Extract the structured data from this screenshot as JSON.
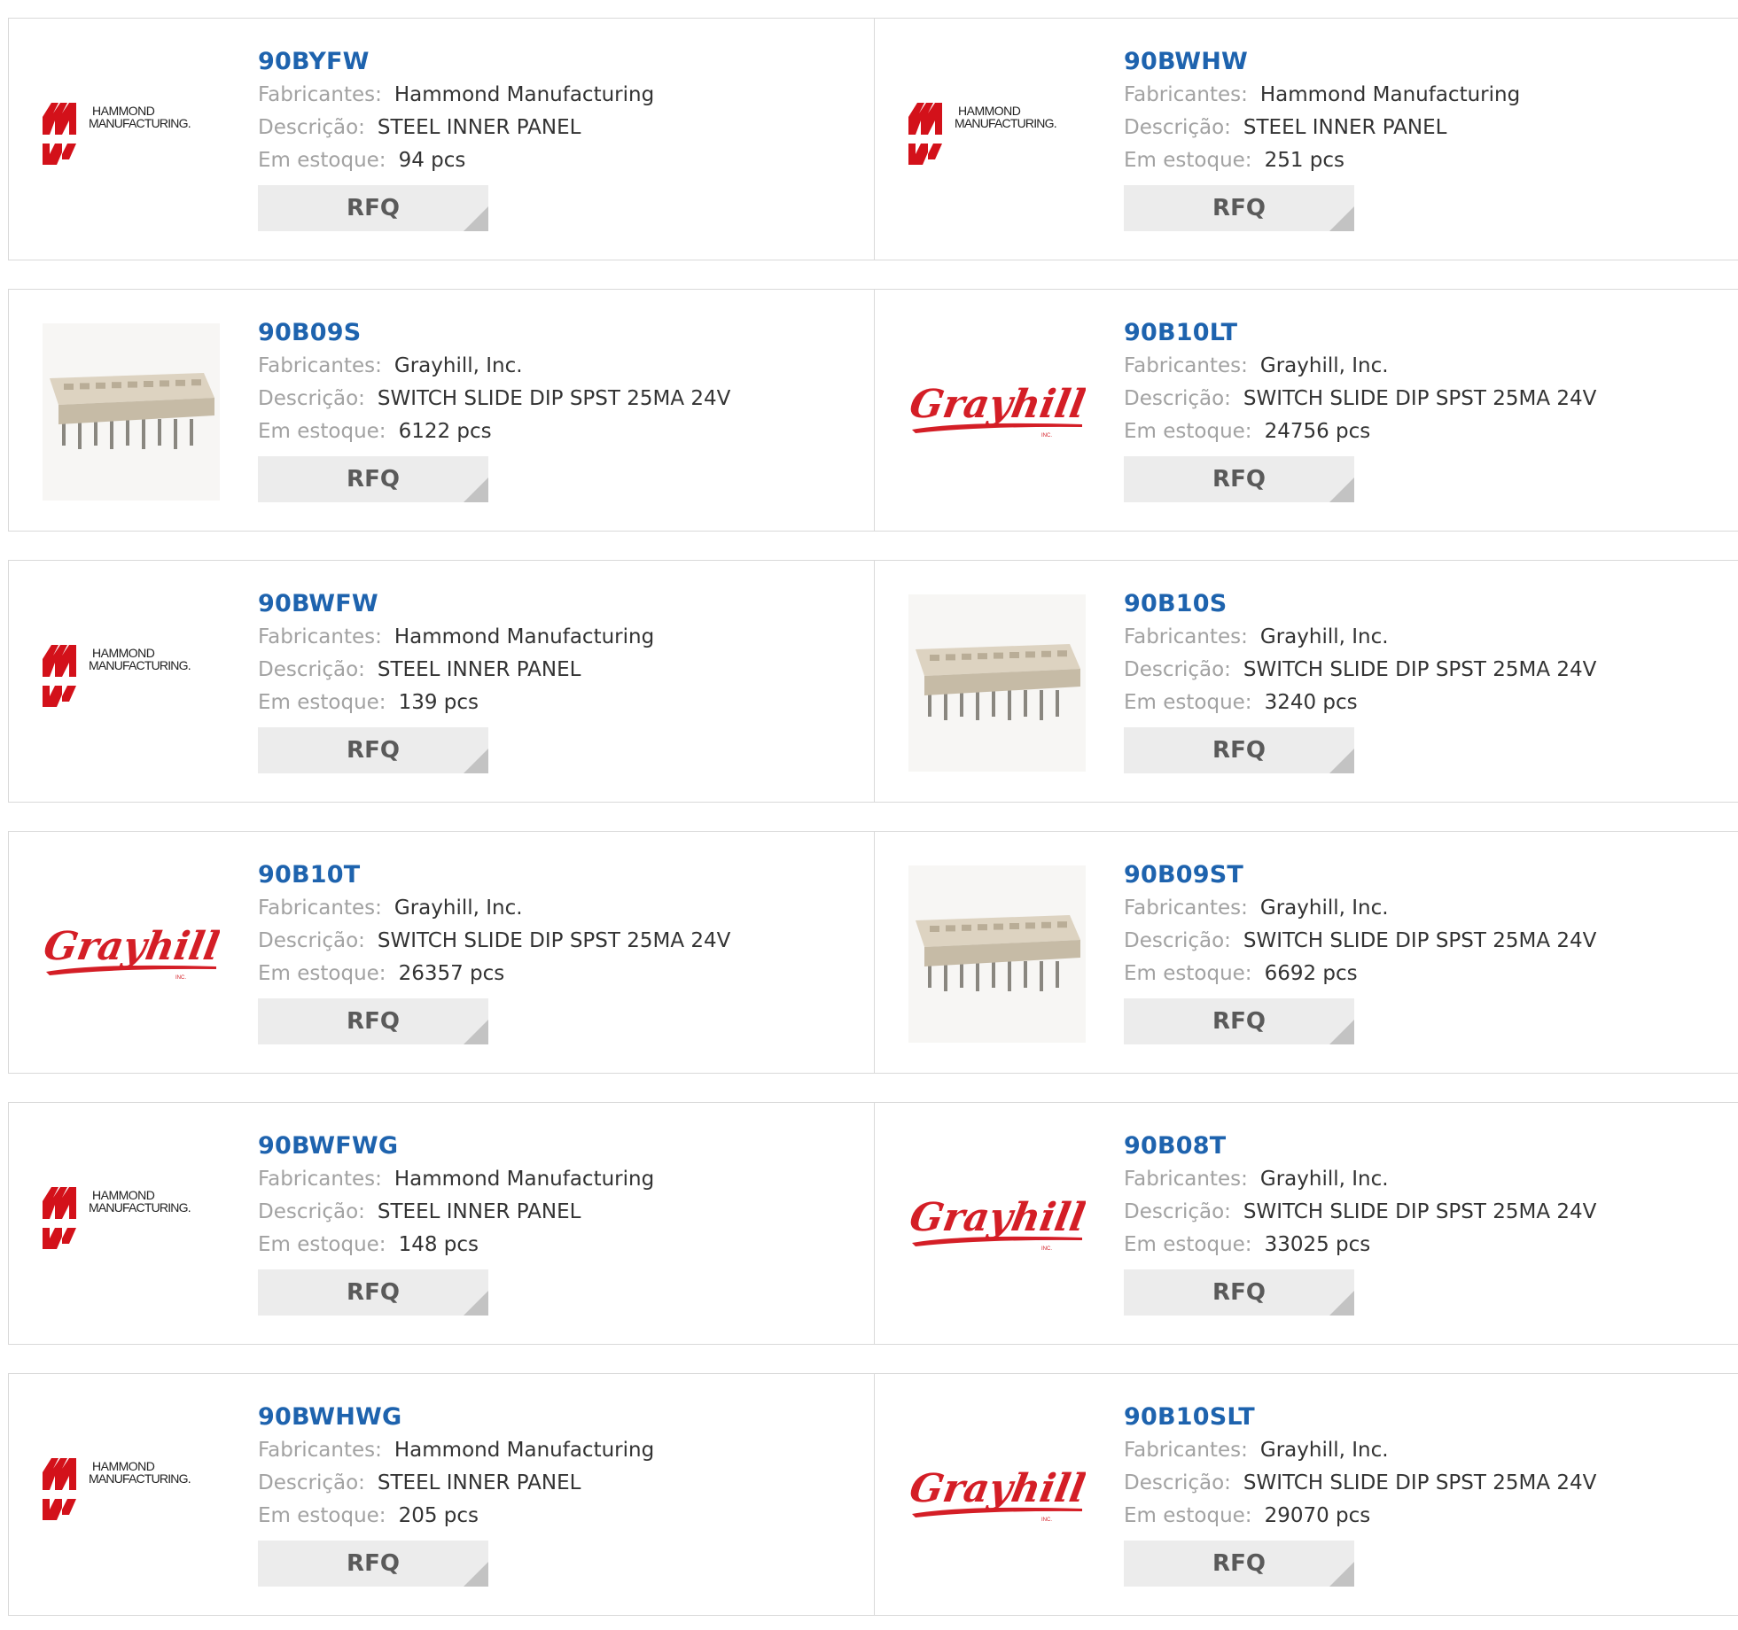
{
  "labels": {
    "manufacturer": "Fabricantes:",
    "description": "Descrição:",
    "stock": "Em estoque:",
    "rfq": "RFQ"
  },
  "colors": {
    "part_link": "#1e63ae",
    "label": "#a2a2a2",
    "hammond_red": "#d3111a",
    "grayhill_red": "#d41e26",
    "rfq_bg": "#ececec"
  },
  "logos": {
    "hammond": {
      "line1": "HAMMOND",
      "line2": "MANUFACTURING."
    },
    "grayhill": {
      "text": "Grayhill",
      "sub": "INC."
    }
  },
  "products": [
    {
      "part": "90BYFW",
      "manufacturer": "Hammond Manufacturing",
      "description": "STEEL INNER PANEL",
      "stock": "94 pcs",
      "image": "hammond-logo"
    },
    {
      "part": "90BWHW",
      "manufacturer": "Hammond Manufacturing",
      "description": "STEEL INNER PANEL",
      "stock": "251 pcs",
      "image": "hammond-logo"
    },
    {
      "part": "90B09S",
      "manufacturer": "Grayhill, Inc.",
      "description": "SWITCH SLIDE DIP SPST 25MA 24V",
      "stock": "6122 pcs",
      "image": "dip-switch-photo"
    },
    {
      "part": "90B10LT",
      "manufacturer": "Grayhill, Inc.",
      "description": "SWITCH SLIDE DIP SPST 25MA 24V",
      "stock": "24756 pcs",
      "image": "grayhill-logo"
    },
    {
      "part": "90BWFW",
      "manufacturer": "Hammond Manufacturing",
      "description": "STEEL INNER PANEL",
      "stock": "139 pcs",
      "image": "hammond-logo"
    },
    {
      "part": "90B10S",
      "manufacturer": "Grayhill, Inc.",
      "description": "SWITCH SLIDE DIP SPST 25MA 24V",
      "stock": "3240 pcs",
      "image": "dip-switch-photo"
    },
    {
      "part": "90B10T",
      "manufacturer": "Grayhill, Inc.",
      "description": "SWITCH SLIDE DIP SPST 25MA 24V",
      "stock": "26357 pcs",
      "image": "grayhill-logo"
    },
    {
      "part": "90B09ST",
      "manufacturer": "Grayhill, Inc.",
      "description": "SWITCH SLIDE DIP SPST 25MA 24V",
      "stock": "6692 pcs",
      "image": "dip-switch-photo"
    },
    {
      "part": "90BWFWG",
      "manufacturer": "Hammond Manufacturing",
      "description": "STEEL INNER PANEL",
      "stock": "148 pcs",
      "image": "hammond-logo"
    },
    {
      "part": "90B08T",
      "manufacturer": "Grayhill, Inc.",
      "description": "SWITCH SLIDE DIP SPST 25MA 24V",
      "stock": "33025 pcs",
      "image": "grayhill-logo"
    },
    {
      "part": "90BWHWG",
      "manufacturer": "Hammond Manufacturing",
      "description": "STEEL INNER PANEL",
      "stock": "205 pcs",
      "image": "hammond-logo"
    },
    {
      "part": "90B10SLT",
      "manufacturer": "Grayhill, Inc.",
      "description": "SWITCH SLIDE DIP SPST 25MA 24V",
      "stock": "29070 pcs",
      "image": "grayhill-logo"
    }
  ]
}
